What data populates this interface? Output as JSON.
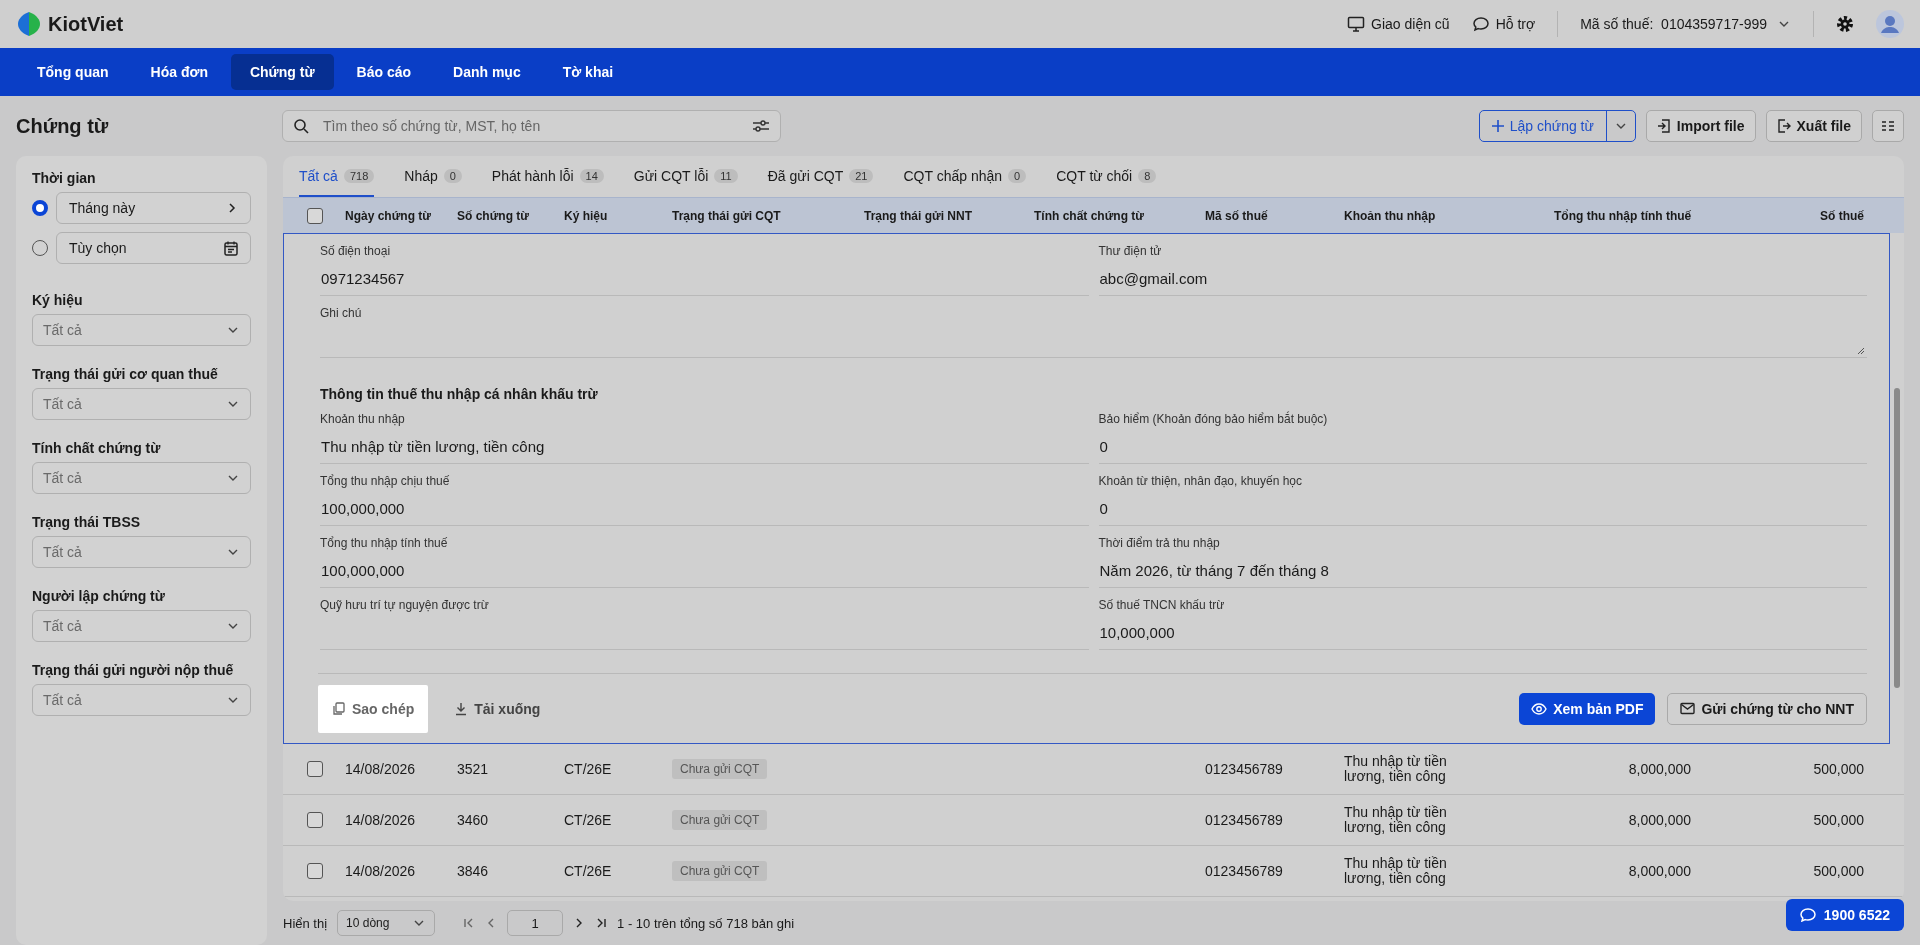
{
  "header": {
    "logo": "KiotViet",
    "links": [
      {
        "kind": "monitor",
        "label": "Giao diện cũ"
      },
      {
        "kind": "chat",
        "label": "Hỗ trợ"
      }
    ],
    "tax_code_label": "Mã số thuế:",
    "tax_code": "0104359717-999"
  },
  "nav": [
    {
      "label": "Tổng quan",
      "selected": false
    },
    {
      "label": "Hóa đơn",
      "selected": false
    },
    {
      "label": "Chứng từ",
      "selected": true
    },
    {
      "label": "Báo cáo",
      "selected": false
    },
    {
      "label": "Danh mục",
      "selected": false
    },
    {
      "label": "Tờ khai",
      "selected": false
    }
  ],
  "page_title": "Chứng từ",
  "search": {
    "placeholder": "Tìm theo số chứng từ, MST, họ tên"
  },
  "actions": {
    "create": "Lập chứng từ",
    "import": "Import file",
    "export": "Xuất file"
  },
  "filters": {
    "time_label": "Thời gian",
    "time_options": [
      {
        "kind": "arrow",
        "label": "Tháng này",
        "selected": true
      },
      {
        "kind": "calendar",
        "label": "Tùy chọn",
        "selected": false
      }
    ],
    "selects": [
      {
        "label": "Ký hiệu",
        "placeholder": "Tất cả"
      },
      {
        "label": "Trạng thái gửi cơ quan thuế",
        "placeholder": "Tất cả"
      },
      {
        "label": "Tính chất chứng từ",
        "placeholder": "Tất cả"
      },
      {
        "label": "Trạng thái TBSS",
        "placeholder": "Tất cả"
      },
      {
        "label": "Người lập chứng từ",
        "placeholder": "Tất cả"
      },
      {
        "label": "Trạng thái gửi người nộp thuế",
        "placeholder": "Tất cả"
      }
    ]
  },
  "tabs": [
    {
      "label": "Tất cả",
      "count": "718",
      "selected": true
    },
    {
      "label": "Nháp",
      "count": "0",
      "selected": false
    },
    {
      "label": "Phát hành lỗi",
      "count": "14",
      "selected": false
    },
    {
      "label": "Gửi CQT lỗi",
      "count": "11",
      "selected": false
    },
    {
      "label": "Đã gửi CQT",
      "count": "21",
      "selected": false
    },
    {
      "label": "CQT chấp nhận",
      "count": "0",
      "selected": false
    },
    {
      "label": "CQT từ chối",
      "count": "8",
      "selected": false
    }
  ],
  "table": {
    "all_checked": false,
    "columns": [
      "Ngày chứng từ",
      "Số chứng từ",
      "Ký hiệu",
      "Trạng thái gửi CQT",
      "Trạng thái gửi NNT",
      "Tính chất chứng từ",
      "Mã số thuế",
      "Khoản thu nhập",
      "Tổng thu nhập tính thuế",
      "Số thuế"
    ],
    "detail": {
      "contact_fields": [
        {
          "label": "Số điện thoại",
          "value": "0971234567"
        },
        {
          "label": "Thư điện tử",
          "value": "abc@gmail.com"
        }
      ],
      "note": {
        "label": "Ghi chú"
      },
      "section_title": "Thông tin thuế thu nhập cá nhân khấu trừ",
      "tax_fields": [
        {
          "label": "Khoản thu nhập",
          "value": "Thu nhập từ tiền lương, tiền công"
        },
        {
          "label": "Bảo hiểm (Khoản đóng bảo hiểm bắt buộc)",
          "value": "0"
        },
        {
          "label": "Tổng thu nhập chịu thuế",
          "value": "100,000,000"
        },
        {
          "label": "Khoản từ thiện, nhân đạo, khuyến học",
          "value": "0"
        },
        {
          "label": "Tổng thu nhập tính thuế",
          "value": "100,000,000"
        },
        {
          "label": "Thời điểm trả thu nhập",
          "value": "Năm 2026, từ tháng 7 đến tháng 8"
        },
        {
          "label": "Quỹ hưu trí tự nguyện được trừ"
        },
        {
          "label": "Số thuế TNCN khấu trừ",
          "value": "10,000,000"
        }
      ],
      "actions": [
        {
          "kind": "copy",
          "label": "Sao chép",
          "highlighted": true
        },
        {
          "kind": "download",
          "label": "Tải xuống",
          "highlighted": false
        },
        {
          "kind": "pdf",
          "label": "Xem bản PDF"
        },
        {
          "kind": "send",
          "label": "Gửi chứng từ cho NNT"
        }
      ]
    },
    "rows": [
      {
        "checked": false,
        "date": "14/08/2026",
        "number": "3521",
        "symbol": "CT/26E",
        "cqt_status": "Chưa gửi CQT",
        "tax_code": "0123456789",
        "income": "Thu nhập từ tiền lương, tiền công",
        "total": "8,000,000",
        "tax": "500,000"
      },
      {
        "checked": false,
        "date": "14/08/2026",
        "number": "3460",
        "symbol": "CT/26E",
        "cqt_status": "Chưa gửi CQT",
        "tax_code": "0123456789",
        "income": "Thu nhập từ tiền lương, tiền công",
        "total": "8,000,000",
        "tax": "500,000"
      },
      {
        "checked": false,
        "date": "14/08/2026",
        "number": "3846",
        "symbol": "CT/26E",
        "cqt_status": "Chưa gửi CQT",
        "tax_code": "0123456789",
        "income": "Thu nhập từ tiền lương, tiền công",
        "total": "8,000,000",
        "tax": "500,000"
      }
    ]
  },
  "pagination": {
    "show_label": "Hiển thị",
    "page_size": "10 dòng",
    "page": "1",
    "summary": "1 - 10 trên tổng số 718 bản ghi"
  },
  "hotline": "1900 6522"
}
